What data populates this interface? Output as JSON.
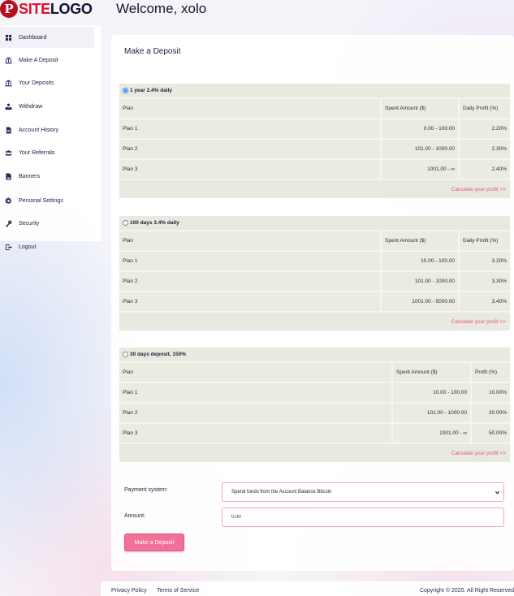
{
  "header": {
    "logo_left": "SITE",
    "logo_right": "LOGO",
    "logo_mark": "P",
    "welcome": "Welcome, xolo"
  },
  "sidebar": {
    "items": [
      {
        "label": "Dashboard",
        "icon": "dashboard-icon",
        "active": true
      },
      {
        "label": "Make A Deposit",
        "icon": "bank-icon"
      },
      {
        "label": "Your Deposits",
        "icon": "bank-icon"
      },
      {
        "label": "Withdraw",
        "icon": "hand-money-icon"
      },
      {
        "label": "Account History",
        "icon": "document-icon"
      },
      {
        "label": "Your Referrals",
        "icon": "users-icon"
      },
      {
        "label": "Banners",
        "icon": "file-image-icon"
      },
      {
        "label": "Personal Settings",
        "icon": "gear-icon"
      },
      {
        "label": "Security",
        "icon": "key-icon"
      },
      {
        "label": "Logout",
        "icon": "logout-icon"
      }
    ]
  },
  "main": {
    "title": "Make a Deposit",
    "columns": {
      "plan": "Plan",
      "spent": "Spent Amount ($)",
      "daily": "Daily Profit (%)",
      "profit": "Profit (%)"
    },
    "calc_link": "Calculate your profit >>",
    "plans": [
      {
        "name": "1 year 2.4% daily",
        "selected": true,
        "profit_header": "Daily Profit (%)",
        "rows": [
          {
            "plan": "Plan 1",
            "spent": "0.00 - 100.00",
            "profit": "2.20%"
          },
          {
            "plan": "Plan 2",
            "spent": "101.00 - 1000.00",
            "profit": "2.30%"
          },
          {
            "plan": "Plan 3",
            "spent": "1001.00 - ∞",
            "profit": "2.40%"
          }
        ]
      },
      {
        "name": "100 days 3.4% daily",
        "selected": false,
        "profit_header": "Daily Profit (%)",
        "rows": [
          {
            "plan": "Plan 1",
            "spent": "10.00 - 100.00",
            "profit": "3.20%"
          },
          {
            "plan": "Plan 2",
            "spent": "101.00 - 1000.00",
            "profit": "3.30%"
          },
          {
            "plan": "Plan 3",
            "spent": "1001.00 - 5000.00",
            "profit": "3.40%"
          }
        ]
      },
      {
        "name": "30 days deposit, 150%",
        "selected": false,
        "profit_header": "Profit (%)",
        "rows": [
          {
            "plan": "Plan 1",
            "spent": "10.00 - 100.00",
            "profit": "10.00%"
          },
          {
            "plan": "Plan 2",
            "spent": "101.00 - 1000.00",
            "profit": "20.00%"
          },
          {
            "plan": "Plan 3",
            "spent": "1001.00 - ∞",
            "profit": "50.00%"
          }
        ]
      }
    ],
    "form": {
      "payment_label": "Payment system:",
      "payment_value": "Spend funds from the Account Balance Bitcoin",
      "amount_label": "Amount:",
      "amount_value": "0.00",
      "submit_label": "Make a Deposit"
    }
  },
  "footer": {
    "privacy": "Privacy Policy",
    "terms": "Terms of Service",
    "copyright": "Copyright © 2025. All Right Reserved"
  },
  "colors": {
    "accent": "#f07098",
    "logo_red": "#e10f2a",
    "link": "#e5577f",
    "table_bg": "#e9e9df"
  }
}
